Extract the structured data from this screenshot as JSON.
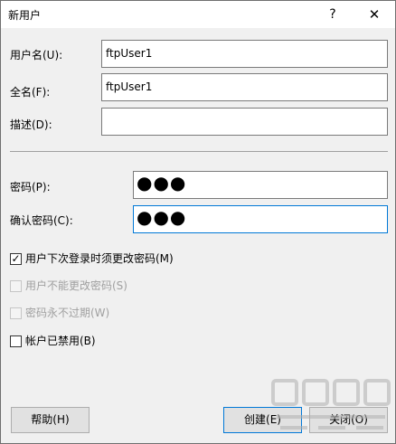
{
  "dialog": {
    "title": "新用户",
    "help_glyph": "?",
    "close_glyph": "✕"
  },
  "fields": {
    "username": {
      "label": "用户名(U):",
      "value": "ftpUser1"
    },
    "fullname": {
      "label": "全名(F):",
      "value": "ftpUser1"
    },
    "description": {
      "label": "描述(D):",
      "value": ""
    },
    "password": {
      "label": "密码(P):",
      "value": "●●●"
    },
    "confirm": {
      "label": "确认密码(C):",
      "value": "●●●"
    }
  },
  "options": [
    {
      "label": "用户下次登录时须更改密码(M)",
      "checked": true,
      "enabled": true,
      "mark": "✓"
    },
    {
      "label": "用户不能更改密码(S)",
      "checked": false,
      "enabled": false
    },
    {
      "label": "密码永不过期(W)",
      "checked": false,
      "enabled": false
    },
    {
      "label": "帐户已禁用(B)",
      "checked": false,
      "enabled": true
    }
  ],
  "buttons": {
    "help": "帮助(H)",
    "create": "创建(E)",
    "close": "关闭(O)"
  },
  "colors": {
    "focus_border": "#0078d7",
    "button_face": "#e1e1e1",
    "dialog_bg": "#f0f0f0"
  }
}
